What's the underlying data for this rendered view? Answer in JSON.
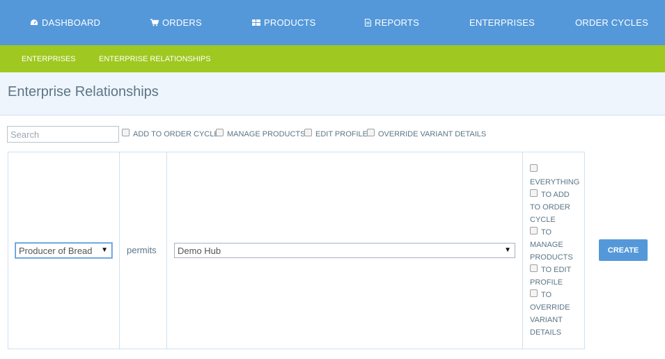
{
  "topnav": {
    "items": [
      {
        "label": "DASHBOARD",
        "icon": "dashboard-icon"
      },
      {
        "label": "ORDERS",
        "icon": "cart-icon"
      },
      {
        "label": "PRODUCTS",
        "icon": "grid-icon"
      },
      {
        "label": "REPORTS",
        "icon": "document-icon"
      },
      {
        "label": "ENTERPRISES",
        "icon": ""
      },
      {
        "label": "ORDER CYCLES",
        "icon": ""
      }
    ]
  },
  "subnav": {
    "items": [
      {
        "label": "ENTERPRISES"
      },
      {
        "label": "ENTERPRISE RELATIONSHIPS",
        "active": true
      }
    ]
  },
  "page": {
    "title": "Enterprise Relationships"
  },
  "filters": {
    "search_placeholder": "Search",
    "options": [
      {
        "label": "ADD TO ORDER CYCLE",
        "checked": false
      },
      {
        "label": "MANAGE PRODUCTS",
        "checked": false
      },
      {
        "label": "EDIT PROFILE",
        "checked": false
      },
      {
        "label": "OVERRIDE VARIANT DETAILS",
        "checked": false
      }
    ]
  },
  "form": {
    "parent_select": "Producer of Bread",
    "permits_text": "permits",
    "child_select": "Demo Hub",
    "permissions": {
      "everything": "EVERYTHING",
      "add_to_order_cycle": [
        "TO ADD",
        "TO ORDER",
        "CYCLE"
      ],
      "manage_products": [
        "TO",
        "MANAGE",
        "PRODUCTS"
      ],
      "edit_profile": [
        "TO EDIT",
        "PROFILE"
      ],
      "override_variant": [
        "TO",
        "OVERRIDE",
        "VARIANT",
        "DETAILS"
      ]
    },
    "create_label": "CREATE"
  },
  "colors": {
    "topnav_bg": "#5498da",
    "subnav_bg": "#9fc820",
    "header_bg": "#eff5fc",
    "text_muted": "#5b7587"
  }
}
